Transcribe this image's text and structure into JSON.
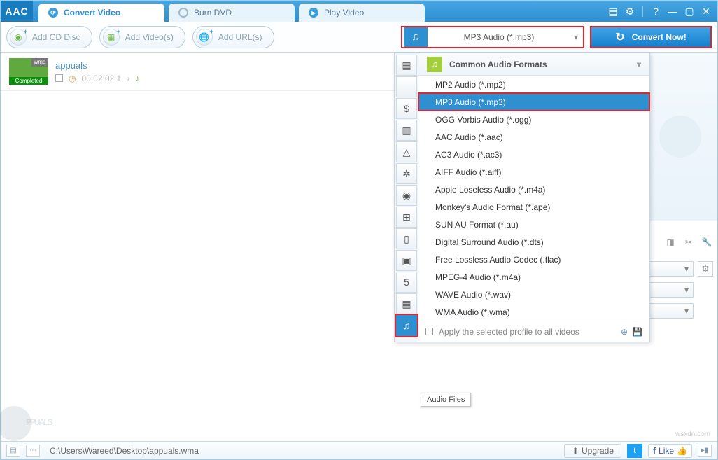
{
  "brand": "AAC",
  "tabs": [
    {
      "label": "Convert Video",
      "active": true
    },
    {
      "label": "Burn DVD",
      "active": false
    },
    {
      "label": "Play Video",
      "active": false
    }
  ],
  "ribbon": {
    "add_cd": "Add CD Disc",
    "add_videos": "Add Video(s)",
    "add_urls": "Add URL(s)"
  },
  "format_selected": "MP3 Audio (*.mp3)",
  "convert_label": "Convert Now!",
  "file": {
    "name": "appuals",
    "badge": "wma",
    "status": "Completed",
    "duration": "00:02:02.1"
  },
  "format_panel": {
    "header": "Common Audio Formats",
    "items": [
      {
        "label": "MP2 Audio (*.mp2)",
        "selected": false
      },
      {
        "label": "MP3 Audio (*.mp3)",
        "selected": true
      },
      {
        "label": "OGG Vorbis Audio (*.ogg)",
        "selected": false
      },
      {
        "label": "AAC Audio (*.aac)",
        "selected": false
      },
      {
        "label": "AC3 Audio (*.ac3)",
        "selected": false
      },
      {
        "label": "AIFF Audio (*.aiff)",
        "selected": false
      },
      {
        "label": "Apple Loseless Audio (*.m4a)",
        "selected": false
      },
      {
        "label": "Monkey's Audio Format (*.ape)",
        "selected": false
      },
      {
        "label": "SUN AU Format (*.au)",
        "selected": false
      },
      {
        "label": "Digital Surround Audio (*.dts)",
        "selected": false
      },
      {
        "label": "Free Lossless Audio Codec (.flac)",
        "selected": false
      },
      {
        "label": "MPEG-4 Audio (*.m4a)",
        "selected": false
      },
      {
        "label": "WAVE Audio (*.wav)",
        "selected": false
      },
      {
        "label": "WMA Audio (*.wma)",
        "selected": false
      }
    ],
    "tooltip": "Audio Files",
    "apply_all": "Apply the selected profile to all videos"
  },
  "side_tabs": [
    "▦",
    "",
    "$",
    "▤",
    "▲",
    "※",
    "◉",
    "⊞",
    "▭",
    "▣",
    "5",
    "▦",
    "♫"
  ],
  "status": {
    "path": "C:\\Users\\Wareed\\Desktop\\appuals.wma",
    "upgrade": "Upgrade",
    "like": "Like"
  },
  "watermark": "PPUALS",
  "source": "wsxdn.com"
}
